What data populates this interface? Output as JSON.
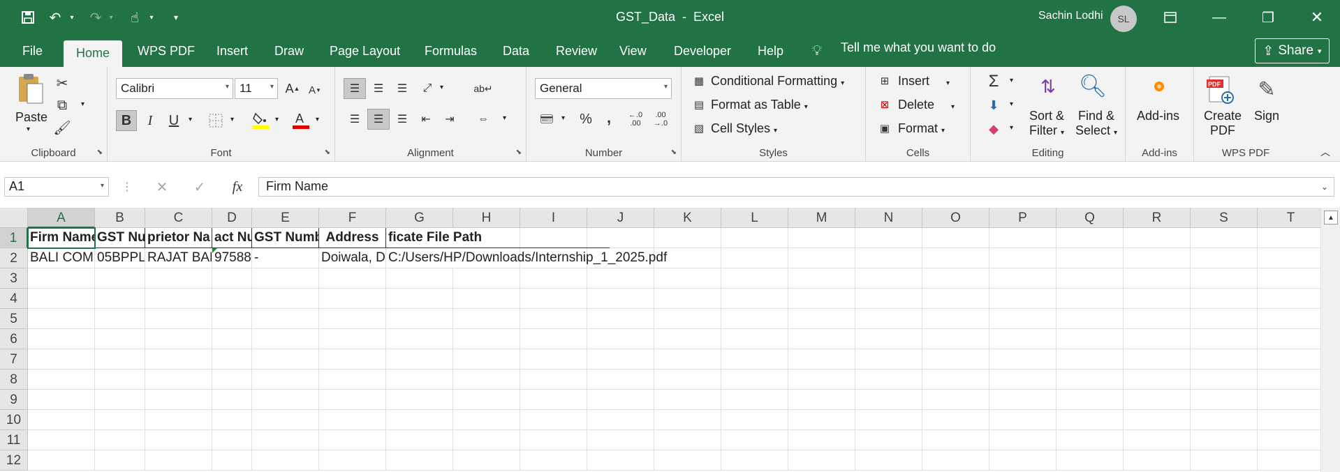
{
  "window": {
    "doc_name": "GST_Data",
    "app_name": "Excel",
    "separator": "  -  ",
    "user_name": "Sachin Lodhi",
    "avatar_initials": "SL"
  },
  "tabs": [
    "File",
    "Home",
    "WPS PDF",
    "Insert",
    "Draw",
    "Page Layout",
    "Formulas",
    "Data",
    "Review",
    "View",
    "Developer",
    "Help"
  ],
  "tell_me": "Tell me what you want to do",
  "share_label": "Share",
  "ribbon": {
    "clipboard": {
      "label": "Clipboard",
      "paste": "Paste"
    },
    "font": {
      "label": "Font",
      "font_name": "Calibri",
      "font_size": "11",
      "bold": "B",
      "italic": "I",
      "underline": "U",
      "font_color": "#e00000",
      "fill_color": "#ffff00"
    },
    "alignment": {
      "label": "Alignment"
    },
    "number": {
      "label": "Number",
      "format": "General",
      "percent": "%",
      "comma": ",",
      "inc_decimal": "←.0\n.00",
      "dec_decimal": ".00\n→.0"
    },
    "styles": {
      "label": "Styles",
      "conditional": "Conditional Formatting",
      "format_table": "Format as Table",
      "cell_styles": "Cell Styles"
    },
    "cells": {
      "label": "Cells",
      "insert": "Insert",
      "delete": "Delete",
      "format": "Format"
    },
    "editing": {
      "label": "Editing",
      "sort_filter_1": "Sort &",
      "sort_filter_2": "Filter",
      "find_select_1": "Find &",
      "find_select_2": "Select"
    },
    "addins": {
      "label": "Add-ins",
      "addins": "Add-ins"
    },
    "wpspdf": {
      "label": "WPS PDF",
      "create_1": "Create",
      "create_2": "PDF",
      "sign": "Sign"
    }
  },
  "formula_bar": {
    "name_box": "A1",
    "formula": "Firm Name"
  },
  "columns": [
    "A",
    "B",
    "C",
    "D",
    "E",
    "F",
    "G",
    "H",
    "I",
    "J",
    "K",
    "L",
    "M",
    "N",
    "O",
    "P",
    "Q",
    "R",
    "S",
    "T"
  ],
  "rows": [
    "1",
    "2",
    "3",
    "4",
    "5",
    "6",
    "7",
    "8",
    "9",
    "10",
    "11",
    "12"
  ],
  "cells": {
    "r1": {
      "a": "Firm Name",
      "b": "GST Nu",
      "c": "prietor Na",
      "d": "act Nu",
      "e": "GST Numbe",
      "f": "Address",
      "g": "ficate File Path"
    },
    "r2": {
      "a": "BALI COM",
      "b": "05BPPL",
      "c": "RAJAT BAL",
      "d": "97588",
      "e": "-",
      "f": "Doiwala, D",
      "g": "C:/Users/HP/Downloads/Internship_1_2025.pdf"
    }
  },
  "colors": {
    "excel_green": "#217346",
    "ribbon_bg": "#f3f3f3"
  }
}
